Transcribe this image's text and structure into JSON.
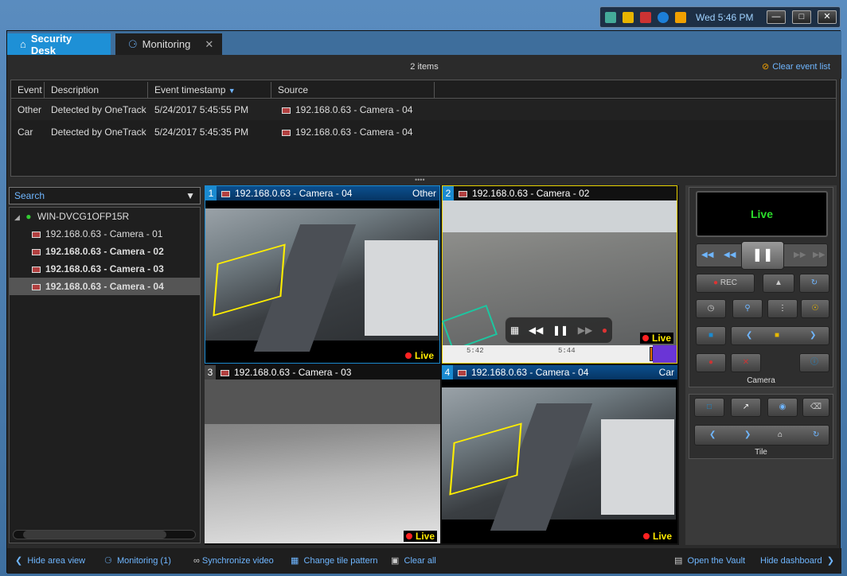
{
  "taskbar": {
    "clock": "Wed 5:46 PM"
  },
  "tabs": [
    {
      "label": "Security Desk"
    },
    {
      "label": "Monitoring"
    }
  ],
  "events": {
    "count_label": "2 items",
    "clear_label": "Clear event list",
    "columns": [
      "Event",
      "Description",
      "Event timestamp",
      "Source"
    ],
    "rows": [
      {
        "event": "Other",
        "description": "Detected by OneTrack",
        "timestamp": "5/24/2017 5:45:55 PM",
        "source": "192.168.0.63 - Camera - 04"
      },
      {
        "event": "Car",
        "description": "Detected by OneTrack",
        "timestamp": "5/24/2017 5:45:35 PM",
        "source": "192.168.0.63 - Camera - 04"
      }
    ]
  },
  "area": {
    "search_placeholder": "Search",
    "root": "WIN-DVCG1OFP15R",
    "cameras": [
      "192.168.0.63 - Camera - 01",
      "192.168.0.63 - Camera - 02",
      "192.168.0.63 - Camera - 03",
      "192.168.0.63 - Camera - 04"
    ]
  },
  "tiles": [
    {
      "num": "1",
      "camera": "192.168.0.63 - Camera - 04",
      "tag": "Other",
      "live": "Live"
    },
    {
      "num": "2",
      "camera": "192.168.0.63 - Camera - 02",
      "tag": "",
      "live": "Live",
      "timeline": [
        "5:42",
        "5:44"
      ]
    },
    {
      "num": "3",
      "camera": "192.168.0.63 - Camera - 03",
      "tag": "",
      "live": "Live"
    },
    {
      "num": "4",
      "camera": "192.168.0.63 - Camera - 04",
      "tag": "Car",
      "live": "Live"
    }
  ],
  "dashboard": {
    "live_display": "Live",
    "rec_label": "REC",
    "camera_section": "Camera",
    "tile_section": "Tile"
  },
  "bottom": {
    "hide_area": "Hide area view",
    "monitoring": "Monitoring (1)",
    "sync": "Synchronize video",
    "change_tile": "Change tile pattern",
    "clear_all": "Clear all",
    "vault": "Open the Vault",
    "hide_dash": "Hide dashboard"
  }
}
